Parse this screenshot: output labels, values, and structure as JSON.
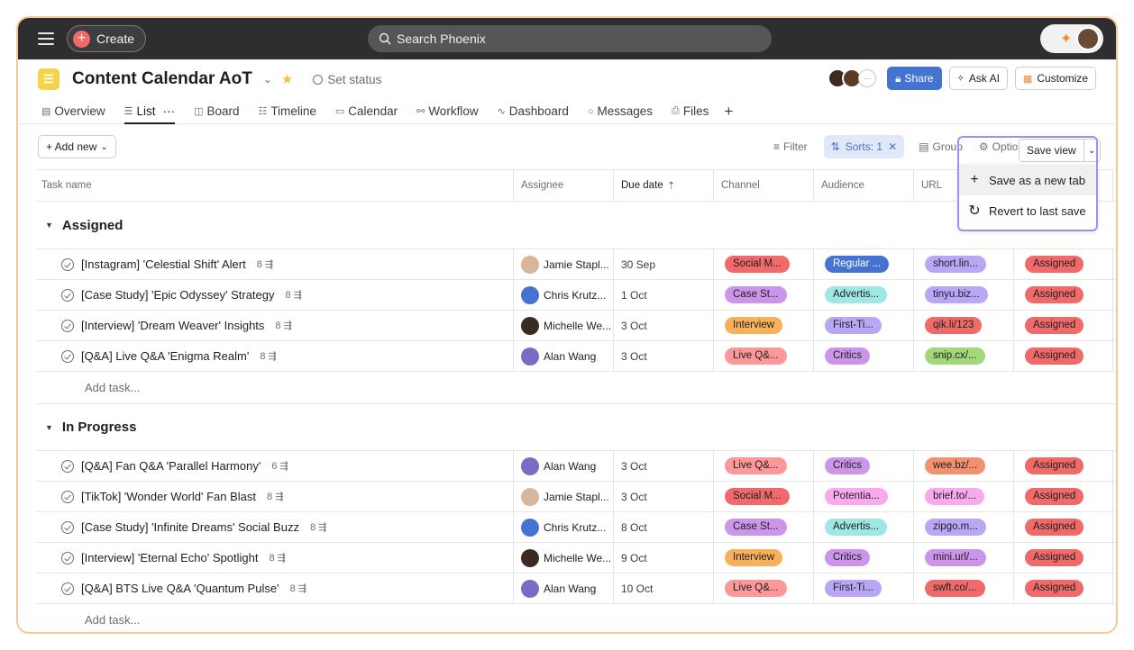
{
  "topbar": {
    "create_label": "Create",
    "search_placeholder": "Search Phoenix"
  },
  "project": {
    "title": "Content Calendar AoT",
    "set_status": "Set status",
    "share": "Share",
    "ask_ai": "Ask AI",
    "customize": "Customize"
  },
  "tabs": [
    {
      "label": "Overview",
      "icon": "overview-icon"
    },
    {
      "label": "List",
      "icon": "list-icon"
    },
    {
      "label": "Board",
      "icon": "board-icon"
    },
    {
      "label": "Timeline",
      "icon": "timeline-icon"
    },
    {
      "label": "Calendar",
      "icon": "calendar-icon"
    },
    {
      "label": "Workflow",
      "icon": "workflow-icon"
    },
    {
      "label": "Dashboard",
      "icon": "dashboard-icon"
    },
    {
      "label": "Messages",
      "icon": "messages-icon"
    },
    {
      "label": "Files",
      "icon": "files-icon"
    }
  ],
  "toolbar": {
    "add_new": "+ Add new",
    "filter": "Filter",
    "sorts": "Sorts: 1",
    "group": "Group",
    "options": "Options",
    "save_view": "Save view"
  },
  "save_menu": {
    "save_new_tab": "Save as a new tab",
    "revert": "Revert to last save"
  },
  "columns": [
    "Task name",
    "Assignee",
    "Due date",
    "Channel",
    "Audience",
    "URL",
    ""
  ],
  "sections": [
    {
      "name": "Assigned",
      "add_task": "Add task...",
      "rows": [
        {
          "task": "[Instagram] 'Celestial Shift' Alert",
          "sub": "8",
          "assignee": "Jamie Stapl...",
          "due": "30 Sep",
          "channel": "Social M...",
          "audience": "Regular ...",
          "url": "short.lin...",
          "status": "Assigned"
        },
        {
          "task": "[Case Study] 'Epic Odyssey' Strategy",
          "sub": "8",
          "assignee": "Chris Krutz...",
          "due": "1 Oct",
          "channel": "Case St...",
          "audience": "Advertis...",
          "url": "tinyu.biz...",
          "status": "Assigned"
        },
        {
          "task": "[Interview] 'Dream Weaver' Insights",
          "sub": "8",
          "assignee": "Michelle We...",
          "due": "3 Oct",
          "channel": "Interview",
          "audience": "First-Ti...",
          "url": "qik.li/123",
          "status": "Assigned"
        },
        {
          "task": "[Q&A] Live Q&A 'Enigma Realm'",
          "sub": "8",
          "assignee": "Alan Wang",
          "due": "3 Oct",
          "channel": "Live Q&...",
          "audience": "Critics",
          "url": "snip.cx/...",
          "status": "Assigned"
        }
      ]
    },
    {
      "name": "In Progress",
      "add_task": "Add task...",
      "rows": [
        {
          "task": "[Q&A] Fan Q&A 'Parallel Harmony'",
          "sub": "6",
          "assignee": "Alan Wang",
          "due": "3 Oct",
          "channel": "Live Q&...",
          "audience": "Critics",
          "url": "wee.bz/...",
          "status": "Assigned"
        },
        {
          "task": "[TikTok] 'Wonder World' Fan Blast",
          "sub": "8",
          "assignee": "Jamie Stapl...",
          "due": "3 Oct",
          "channel": "Social M...",
          "audience": "Potentia...",
          "url": "brief.to/...",
          "status": "Assigned"
        },
        {
          "task": "[Case Study] 'Infinite Dreams' Social Buzz",
          "sub": "8",
          "assignee": "Chris Krutz...",
          "due": "8 Oct",
          "channel": "Case St...",
          "audience": "Advertis...",
          "url": "zipgo.m...",
          "status": "Assigned"
        },
        {
          "task": "[Interview] 'Eternal Echo' Spotlight",
          "sub": "8",
          "assignee": "Michelle We...",
          "due": "9 Oct",
          "channel": "Interview",
          "audience": "Critics",
          "url": "mini.url/...",
          "status": "Assigned"
        },
        {
          "task": "[Q&A] BTS Live Q&A 'Quantum Pulse'",
          "sub": "8",
          "assignee": "Alan Wang",
          "due": "10 Oct",
          "channel": "Live Q&...",
          "audience": "First-Ti...",
          "url": "swft.co/...",
          "status": "Assigned"
        }
      ]
    }
  ],
  "colors": {
    "channel": {
      "Social M...": "#f06a6a",
      "Case St...": "#cd95ea",
      "Interview": "#f8b15a",
      "Live Q&...": "#fc979a"
    },
    "audience": {
      "Regular ...": "#4573d2",
      "Advertis...": "#9ee7e3",
      "First-Ti...": "#b9a7f5",
      "Critics": "#cd95ea",
      "Potentia...": "#f9aaef"
    },
    "url": {
      "short.lin...": "#b9a7f5",
      "tinyu.biz...": "#b9a7f5",
      "qik.li/123": "#f06a6a",
      "snip.cx/...": "#a3d87a",
      "wee.bz/...": "#f3916f",
      "brief.to/...": "#f9aaef",
      "zipgo.m...": "#b9a7f5",
      "mini.url/...": "#cd95ea",
      "swft.co/...": "#f06a6a"
    },
    "status": "#f06a6a",
    "avatars": {
      "Jamie Stapl...": "#d9b59a",
      "Chris Krutz...": "#4573d2",
      "Michelle We...": "#3b2a20",
      "Alan Wang": "#7a6cc4"
    }
  }
}
